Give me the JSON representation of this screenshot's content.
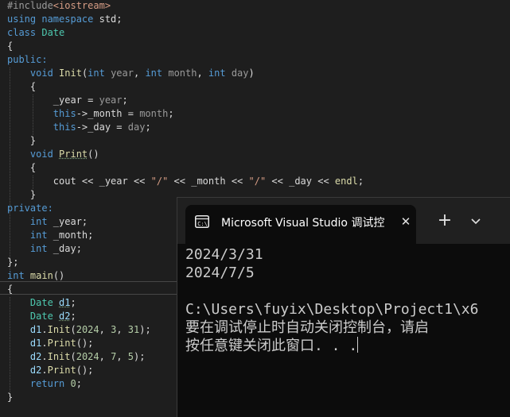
{
  "editor": {
    "lines": [
      [
        {
          "t": "#include",
          "c": "pp"
        },
        {
          "t": "<iostream>",
          "c": "inc"
        }
      ],
      [
        {
          "t": "using ",
          "c": "kw"
        },
        {
          "t": "namespace ",
          "c": "kw"
        },
        {
          "t": "std;",
          "c": ""
        }
      ],
      [
        {
          "t": "class ",
          "c": "kw"
        },
        {
          "t": "Date",
          "c": "ty"
        }
      ],
      [
        {
          "t": "{",
          "c": ""
        }
      ],
      [
        {
          "t": "public:",
          "c": "kw"
        }
      ],
      [
        {
          "t": "    void ",
          "c": "kw"
        },
        {
          "t": "Init",
          "c": "fn"
        },
        {
          "t": "(",
          "c": ""
        },
        {
          "t": "int ",
          "c": "kw"
        },
        {
          "t": "year",
          "c": "pm"
        },
        {
          "t": ", ",
          "c": ""
        },
        {
          "t": "int ",
          "c": "kw"
        },
        {
          "t": "month",
          "c": "pm"
        },
        {
          "t": ", ",
          "c": ""
        },
        {
          "t": "int ",
          "c": "kw"
        },
        {
          "t": "day",
          "c": "pm"
        },
        {
          "t": ")",
          "c": ""
        }
      ],
      [
        {
          "t": "    {",
          "c": ""
        }
      ],
      [
        {
          "t": "        _year",
          "c": "mv"
        },
        {
          "t": " = ",
          "c": ""
        },
        {
          "t": "year",
          "c": "pm"
        },
        {
          "t": ";",
          "c": ""
        }
      ],
      [
        {
          "t": "        this",
          "c": "kw"
        },
        {
          "t": "->",
          "c": ""
        },
        {
          "t": "_month",
          "c": "mv"
        },
        {
          "t": " = ",
          "c": ""
        },
        {
          "t": "month",
          "c": "pm"
        },
        {
          "t": ";",
          "c": ""
        }
      ],
      [
        {
          "t": "        this",
          "c": "kw"
        },
        {
          "t": "->",
          "c": ""
        },
        {
          "t": "_day",
          "c": "mv"
        },
        {
          "t": " = ",
          "c": ""
        },
        {
          "t": "day",
          "c": "pm"
        },
        {
          "t": ";",
          "c": ""
        }
      ],
      [
        {
          "t": "    }",
          "c": ""
        }
      ],
      [
        {
          "t": "    void ",
          "c": "kw"
        },
        {
          "t": "Print",
          "c": "fn squig"
        },
        {
          "t": "()",
          "c": ""
        }
      ],
      [
        {
          "t": "    {",
          "c": ""
        }
      ],
      [
        {
          "t": "        cout ",
          "c": ""
        },
        {
          "t": "<< ",
          "c": ""
        },
        {
          "t": "_year",
          "c": "mv"
        },
        {
          "t": " << ",
          "c": ""
        },
        {
          "t": "\"/\"",
          "c": "st"
        },
        {
          "t": " << ",
          "c": ""
        },
        {
          "t": "_month",
          "c": "mv"
        },
        {
          "t": " << ",
          "c": ""
        },
        {
          "t": "\"/\"",
          "c": "st"
        },
        {
          "t": " << ",
          "c": ""
        },
        {
          "t": "_day",
          "c": "mv"
        },
        {
          "t": " << ",
          "c": ""
        },
        {
          "t": "endl",
          "c": "fn"
        },
        {
          "t": ";",
          "c": ""
        }
      ],
      [
        {
          "t": "    }",
          "c": ""
        }
      ],
      [
        {
          "t": "private:",
          "c": "kw"
        }
      ],
      [
        {
          "t": "    int ",
          "c": "kw"
        },
        {
          "t": "_year",
          "c": "mv"
        },
        {
          "t": ";",
          "c": ""
        }
      ],
      [
        {
          "t": "    int ",
          "c": "kw"
        },
        {
          "t": "_month",
          "c": "mv"
        },
        {
          "t": ";",
          "c": ""
        }
      ],
      [
        {
          "t": "    int ",
          "c": "kw"
        },
        {
          "t": "_day",
          "c": "mv"
        },
        {
          "t": ";",
          "c": ""
        }
      ],
      [
        {
          "t": "};",
          "c": ""
        }
      ],
      [
        {
          "t": "int ",
          "c": "kw"
        },
        {
          "t": "main",
          "c": "fn"
        },
        {
          "t": "()",
          "c": ""
        }
      ],
      [
        {
          "t": "{",
          "c": ""
        }
      ],
      [
        {
          "t": "    Date ",
          "c": "ty"
        },
        {
          "t": "d1",
          "c": "lv squig"
        },
        {
          "t": ";",
          "c": ""
        }
      ],
      [
        {
          "t": "    Date ",
          "c": "ty"
        },
        {
          "t": "d2",
          "c": "lv squig"
        },
        {
          "t": ";",
          "c": ""
        }
      ],
      [
        {
          "t": "    d1",
          "c": "lv"
        },
        {
          "t": ".",
          "c": ""
        },
        {
          "t": "Init",
          "c": "fn"
        },
        {
          "t": "(",
          "c": ""
        },
        {
          "t": "2024",
          "c": "nu"
        },
        {
          "t": ", ",
          "c": ""
        },
        {
          "t": "3",
          "c": "nu"
        },
        {
          "t": ", ",
          "c": ""
        },
        {
          "t": "31",
          "c": "nu"
        },
        {
          "t": ");",
          "c": ""
        }
      ],
      [
        {
          "t": "    d1",
          "c": "lv"
        },
        {
          "t": ".",
          "c": ""
        },
        {
          "t": "Print",
          "c": "fn"
        },
        {
          "t": "();",
          "c": ""
        }
      ],
      [
        {
          "t": "    d2",
          "c": "lv"
        },
        {
          "t": ".",
          "c": ""
        },
        {
          "t": "Init",
          "c": "fn"
        },
        {
          "t": "(",
          "c": ""
        },
        {
          "t": "2024",
          "c": "nu"
        },
        {
          "t": ", ",
          "c": ""
        },
        {
          "t": "7",
          "c": "nu"
        },
        {
          "t": ", ",
          "c": ""
        },
        {
          "t": "5",
          "c": "nu"
        },
        {
          "t": ");",
          "c": ""
        }
      ],
      [
        {
          "t": "    d2",
          "c": "lv"
        },
        {
          "t": ".",
          "c": ""
        },
        {
          "t": "Print",
          "c": "fn"
        },
        {
          "t": "();",
          "c": ""
        }
      ],
      [
        {
          "t": "    return ",
          "c": "kw"
        },
        {
          "t": "0",
          "c": "nu"
        },
        {
          "t": ";",
          "c": ""
        }
      ],
      [
        {
          "t": "}",
          "c": ""
        }
      ]
    ]
  },
  "terminal": {
    "tab_title": "Microsoft Visual Studio 调试控",
    "new_tab_label": "+",
    "close_label": "✕",
    "output_lines": [
      "2024/3/31",
      "2024/7/5",
      "",
      "C:\\Users\\fuyix\\Desktop\\Project1\\x6",
      "要在调试停止时自动关闭控制台，请启",
      "按任意键关闭此窗口. . ."
    ]
  },
  "colors": {
    "editor_bg": "#1e1e1e",
    "keyword": "#569cd6",
    "type": "#4ec9b0",
    "function": "#dcdcaa",
    "string": "#d69d85",
    "number": "#b5cea8",
    "terminal_bg": "#0c0c0c",
    "terminal_titlebar": "#202020"
  }
}
